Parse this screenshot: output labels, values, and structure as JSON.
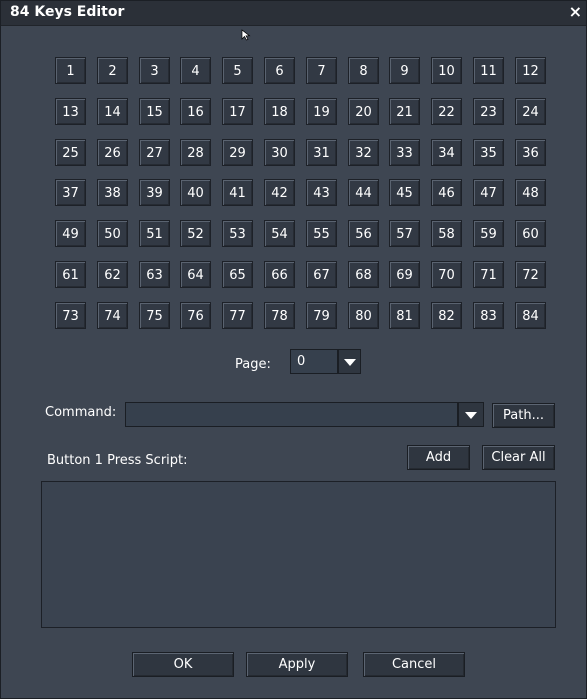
{
  "window": {
    "title": "84 Keys Editor",
    "close_glyph": "×"
  },
  "keys": [
    "1",
    "2",
    "3",
    "4",
    "5",
    "6",
    "7",
    "8",
    "9",
    "10",
    "11",
    "12",
    "13",
    "14",
    "15",
    "16",
    "17",
    "18",
    "19",
    "20",
    "21",
    "22",
    "23",
    "24",
    "25",
    "26",
    "27",
    "28",
    "29",
    "30",
    "31",
    "32",
    "33",
    "34",
    "35",
    "36",
    "37",
    "38",
    "39",
    "40",
    "41",
    "42",
    "43",
    "44",
    "45",
    "46",
    "47",
    "48",
    "49",
    "50",
    "51",
    "52",
    "53",
    "54",
    "55",
    "56",
    "57",
    "58",
    "59",
    "60",
    "61",
    "62",
    "63",
    "64",
    "65",
    "66",
    "67",
    "68",
    "69",
    "70",
    "71",
    "72",
    "73",
    "74",
    "75",
    "76",
    "77",
    "78",
    "79",
    "80",
    "81",
    "82",
    "83",
    "84"
  ],
  "page": {
    "label": "Page:",
    "value": "0"
  },
  "command": {
    "label": "Command:",
    "value": "",
    "path_button": "Path..."
  },
  "script": {
    "label": "Button 1 Press Script:",
    "add_button": "Add",
    "clear_button": "Clear All",
    "content": ""
  },
  "footer": {
    "ok": "OK",
    "apply": "Apply",
    "cancel": "Cancel"
  },
  "icons": {
    "close": "close-icon",
    "dropdown": "chevron-down-icon",
    "cursor": "mouse-cursor-icon"
  }
}
